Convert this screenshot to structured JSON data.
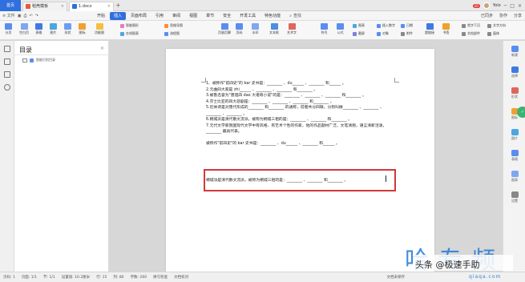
{
  "tabs": {
    "home": "首页",
    "items": [
      {
        "label": "稻壳模板",
        "color": "#e85a3a"
      },
      {
        "label": "1.docx",
        "color": "#2f6fde"
      }
    ]
  },
  "window": {
    "badge": "20",
    "user": "Yolo"
  },
  "menubar": {
    "file": "≡ 文件",
    "tabs": [
      "开始",
      "插入",
      "页面布局",
      "引用",
      "审阅",
      "视图",
      "章节",
      "安全",
      "开发工具",
      "特色功能"
    ],
    "active_tab": "插入",
    "search": "查找",
    "right": [
      "已同步",
      "协作",
      "分享"
    ]
  },
  "ribbon": {
    "big": [
      {
        "label": "分页",
        "color": "#5b8def"
      },
      {
        "label": "空白页",
        "color": "#7fa7ef"
      },
      {
        "label": "表格",
        "color": "#3d7be3"
      },
      {
        "label": "图片",
        "color": "#4aa7e0"
      },
      {
        "label": "形状",
        "color": "#6c9ef0"
      },
      {
        "label": "图标",
        "color": "#f0a030"
      },
      {
        "label": "功能图",
        "color": "#f2c040"
      },
      {
        "label": "页眉页脚",
        "color": "#5b8def"
      },
      {
        "label": "页码",
        "color": "#5b8def"
      },
      {
        "label": "水印",
        "color": "#7fa7ef"
      },
      {
        "label": "文本框",
        "color": "#4a8fe0"
      },
      {
        "label": "艺术字",
        "color": "#e0665a"
      },
      {
        "label": "符号",
        "color": "#5b8def"
      },
      {
        "label": "公式",
        "color": "#5b8def"
      },
      {
        "label": "超链接",
        "color": "#3d7be3"
      },
      {
        "label": "书签",
        "color": "#f0a030"
      }
    ],
    "small": [
      {
        "label": "智能图形",
        "color": "#e57ac0"
      },
      {
        "label": "思维导图",
        "color": "#ff8a3c"
      },
      {
        "label": "在线图表",
        "color": "#4aa7e0"
      },
      {
        "label": "流程图",
        "color": "#5b8def"
      },
      {
        "label": "图表",
        "color": "#4aa7e0"
      },
      {
        "label": "截屏",
        "color": "#7f7fe0"
      },
      {
        "label": "插入数字",
        "color": "#5b8def"
      },
      {
        "label": "对象",
        "color": "#5b8def"
      },
      {
        "label": "日期",
        "color": "#5b8def"
      },
      {
        "label": "附件",
        "color": "#888888"
      },
      {
        "label": "首字下沉",
        "color": "#888888"
      },
      {
        "label": "文档部件",
        "color": "#888888"
      },
      {
        "label": "文字方向",
        "color": "#888888"
      },
      {
        "label": "窗体",
        "color": "#888888"
      }
    ]
  },
  "toc": {
    "title": "目录",
    "item": "智能识别目录"
  },
  "document": {
    "lines": [
      "1、被称作\"前四史\"的 bar 史书是：________ 、du______ 、________ 和______ 。",
      "2.元曲四大家是 zhi______ 、________ 、________ 和________ 。",
      "3.被鲁迅誉为\"唐遗四 dao 大诸奇小说\"的是：________ 、________ 、________ 和________ 。",
      "4.莎士比亚的四大悲剧是：________ 、________ 、________ 和________ 。",
      "5.近体诗是对唐代形成的________ 和________ 的通称，前者共分四联，分别叫做________ 、________ 、________ 、________ 。",
      "6.桐城派是清代散文流派，被称为桐城三祖的是：________ 、________ 和________ 。",
      "7.元代文学家我国现代文学中有风格、有艺术个性的作家，他的作品题材广泛，文笔清丽，语言清新活泼，________ 最具代表。"
    ],
    "repeat_line": "被称作\"前四史\"的 bar 史书是：________ 、du______ 、________ 和______ 。",
    "highlight_line": "桐城派是清代散文流派，被称为桐城三祖的是：________ 、________ 和________ 。"
  },
  "rightbar": [
    {
      "label": "新建",
      "color": "#5b8def"
    },
    {
      "label": "选择",
      "color": "#3d7be3"
    },
    {
      "label": "形状",
      "color": "#e0665a"
    },
    {
      "label": "图标",
      "color": "#f0a030"
    },
    {
      "label": "图片",
      "color": "#4aa7e0"
    },
    {
      "label": "表格",
      "color": "#5b8def"
    },
    {
      "label": "图表",
      "color": "#7fa7ef"
    },
    {
      "label": "设置",
      "color": "#888888"
    }
  ],
  "statusbar": {
    "left": [
      "页码: 1",
      "页面: 1/1",
      "节: 1/1",
      "设置值: 10.2厘米",
      "行: 15",
      "列: 80",
      "字数: 260",
      "拼写检查",
      "文档校对"
    ],
    "right": [
      "文档未保存"
    ]
  },
  "watermark": {
    "logo": "哈 专 频",
    "handle": "头条 @极速手助",
    "url": "qiaqa.com"
  }
}
